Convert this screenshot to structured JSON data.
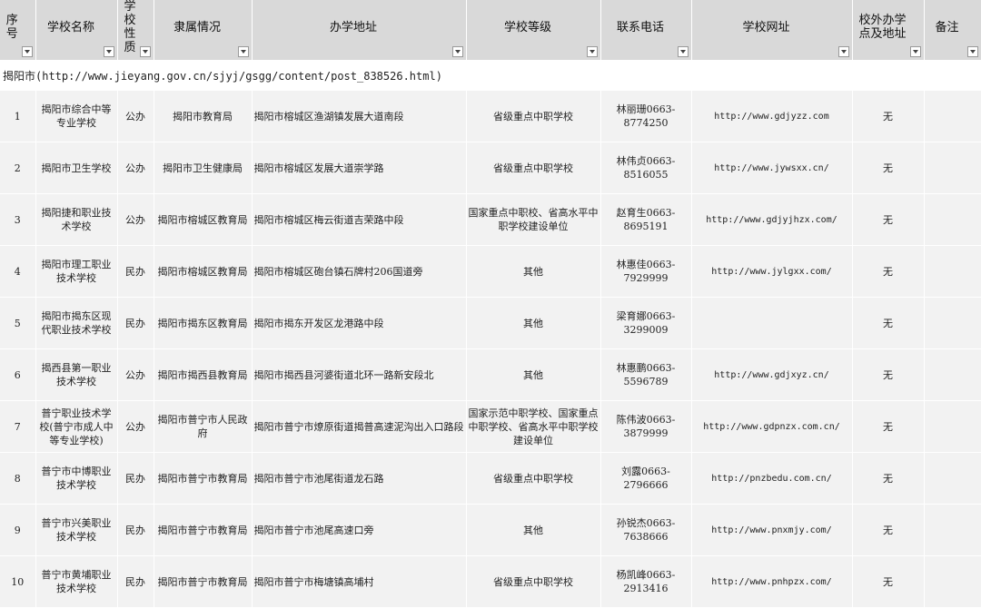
{
  "columns": [
    {
      "label": "序号"
    },
    {
      "label": "学校名称"
    },
    {
      "label": "学校性质"
    },
    {
      "label": "隶属情况"
    },
    {
      "label": "办学地址"
    },
    {
      "label": "学校等级"
    },
    {
      "label": "联系电话"
    },
    {
      "label": "学校网址"
    },
    {
      "label": "校外办学点及地址"
    },
    {
      "label": "备注"
    }
  ],
  "section_title": "揭阳市(http://www.jieyang.gov.cn/sjyj/gsgg/content/post_838526.html)",
  "rows": [
    [
      "1",
      "揭阳市综合中等专业学校",
      "公办",
      "揭阳市教育局",
      "揭阳市榕城区渔湖镇发展大道南段",
      "省级重点中职学校",
      "林丽珊0663-8774250",
      "http://www.gdjyzz.com",
      "无",
      ""
    ],
    [
      "2",
      "揭阳市卫生学校",
      "公办",
      "揭阳市卫生健康局",
      "揭阳市榕城区发展大道崇学路",
      "省级重点中职学校",
      "林伟贞0663-8516055",
      "http://www.jywsxx.cn/",
      "无",
      ""
    ],
    [
      "3",
      "揭阳捷和职业技术学校",
      "公办",
      "揭阳市榕城区教育局",
      "揭阳市榕城区梅云街道吉荣路中段",
      "国家重点中职校、省高水平中职学校建设单位",
      "赵育生0663-8695191",
      "http://www.gdjyjhzx.com/",
      "无",
      ""
    ],
    [
      "4",
      "揭阳市理工职业技术学校",
      "民办",
      "揭阳市榕城区教育局",
      "揭阳市榕城区砲台镇石牌村206国道旁",
      "其他",
      "林惠佳0663-7929999",
      "http://www.jylgxx.com/",
      "无",
      ""
    ],
    [
      "5",
      "揭阳市揭东区现代职业技术学校",
      "民办",
      "揭阳市揭东区教育局",
      "揭阳市揭东开发区龙港路中段",
      "其他",
      "梁育娜0663-3299009",
      "",
      "无",
      ""
    ],
    [
      "6",
      "揭西县第一职业技术学校",
      "公办",
      "揭阳市揭西县教育局",
      "揭阳市揭西县河婆街道北环一路新安段北",
      "其他",
      "林惠鹏0663-5596789",
      "http://www.gdjxyz.cn/",
      "无",
      ""
    ],
    [
      "7",
      "普宁职业技术学校(普宁市成人中等专业学校)",
      "公办",
      "揭阳市普宁市人民政府",
      "揭阳市普宁市燎原街道揭普高速泥沟出入口路段",
      "国家示范中职学校、国家重点中职学校、省高水平中职学校建设单位",
      "陈伟波0663-3879999",
      "http://www.gdpnzx.com.cn/",
      "无",
      ""
    ],
    [
      "8",
      "普宁市中博职业技术学校",
      "民办",
      "揭阳市普宁市教育局",
      "揭阳市普宁市池尾街道龙石路",
      "省级重点中职学校",
      "刘露0663-2796666",
      "http://pnzbedu.com.cn/",
      "无",
      ""
    ],
    [
      "9",
      "普宁市兴美职业技术学校",
      "民办",
      "揭阳市普宁市教育局",
      "揭阳市普宁市池尾高速口旁",
      "其他",
      "孙锐杰0663-7638666",
      "http://www.pnxmjy.com/",
      "无",
      ""
    ],
    [
      "10",
      "普宁市黄埔职业技术学校",
      "民办",
      "揭阳市普宁市教育局",
      "揭阳市普宁市梅塘镇高埔村",
      "省级重点中职学校",
      "杨凯峰0663-2913416",
      "http://www.pnhpzx.com/",
      "无",
      ""
    ]
  ]
}
